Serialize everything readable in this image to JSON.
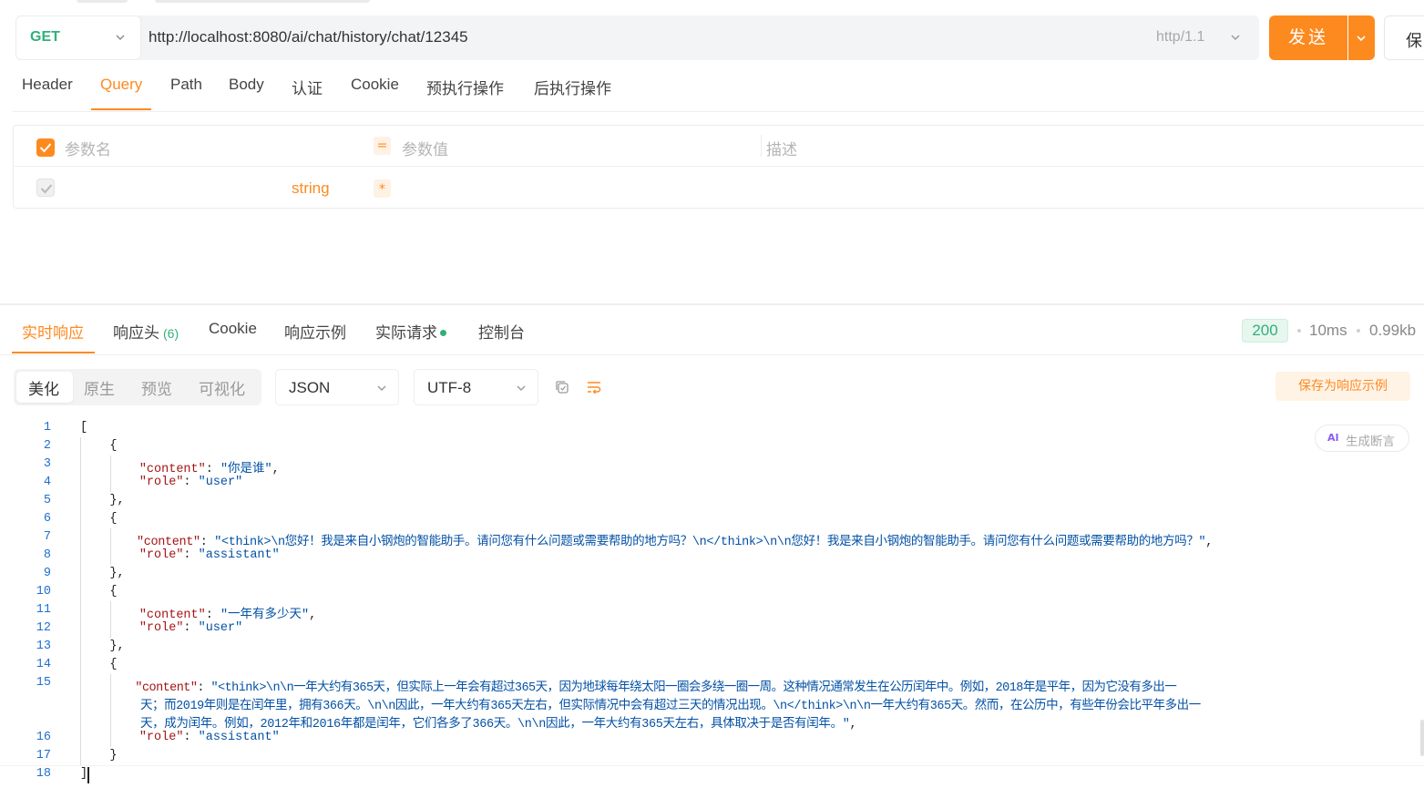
{
  "request": {
    "method": "GET",
    "url": "http://localhost:8080/ai/chat/history/chat/12345",
    "http_version": "http/1.1",
    "send_label": "发送",
    "save_label": "保"
  },
  "param_tabs": [
    "Header",
    "Query",
    "Path",
    "Body",
    "认证",
    "Cookie",
    "预执行操作",
    "后执行操作"
  ],
  "params_table": {
    "headers": {
      "name": "参数名",
      "equals": "=",
      "value": "参数值",
      "description": "描述"
    },
    "row": {
      "type": "string",
      "required": "*"
    }
  },
  "response_tabs": {
    "realtime": "实时响应",
    "headers": "响应头",
    "headers_count": "(6)",
    "cookie": "Cookie",
    "examples": "响应示例",
    "actual_request": "实际请求",
    "console": "控制台"
  },
  "response_meta": {
    "status": "200",
    "time": "10ms",
    "size": "0.99kb"
  },
  "view": {
    "modes": [
      "美化",
      "原生",
      "预览",
      "可视化"
    ],
    "active_mode": "美化",
    "format": "JSON",
    "encoding": "UTF-8",
    "save_example_label": "保存为响应示例",
    "generate_assertion_label": "生成断言",
    "ai_label": "AI"
  },
  "code": {
    "line_numbers": [
      "1",
      "2",
      "3",
      "4",
      "5",
      "6",
      "7",
      "8",
      "9",
      "10",
      "11",
      "12",
      "13",
      "14",
      "15",
      "16",
      "17",
      "18"
    ],
    "tokens": {
      "content_key": "\"content\"",
      "role_key": "\"role\"",
      "msg1": "\"你是谁\"",
      "role_user": "\"user\"",
      "role_assistant": "\"assistant\"",
      "msg2": "\"<think>\\n您好！我是来自小钢炮的智能助手。请问您有什么问题或需要帮助的地方吗？\\n</think>\\n\\n您好！我是来自小钢炮的智能助手。请问您有什么问题或需要帮助的地方吗？\"",
      "msg3": "\"一年有多少天\"",
      "msg4_line1": "\"<think>\\n\\n一年大约有365天，但实际上一年会有超过365天，因为地球每年绕太阳一圈会多绕一圈一周。这种情况通常发生在公历闰年中。例如，2018年是平年，因为它没有多出一",
      "msg4_line2": "天；而2019年则是在闰年里，拥有366天。\\n\\n因此，一年大约有365天左右，但实际情况中会有超过三天的情况出现。\\n</think>\\n\\n一年大约有365天。然而，在公历中，有些年份会比平年多出一",
      "msg4_line3": "天，成为闰年。例如，2012年和2016年都是闰年，它们各多了366天。\\n\\n因此，一年大约有365天左右，具体取决于是否有闰年。\""
    }
  }
}
